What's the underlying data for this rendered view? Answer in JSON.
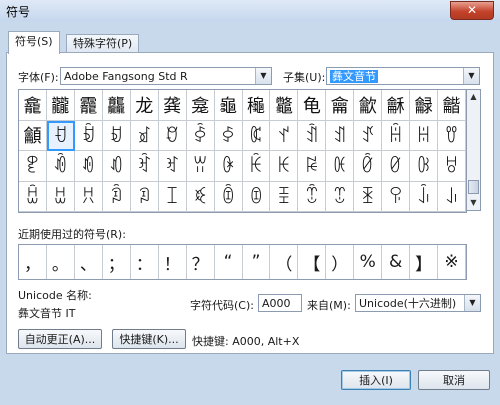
{
  "window": {
    "title": "符号",
    "close_icon": "✕"
  },
  "tabs": [
    {
      "label": "符号(S)",
      "active": true
    },
    {
      "label": "特殊字符(P)",
      "active": false
    }
  ],
  "font": {
    "label": "字体(F):",
    "value": "Adobe Fangsong Std R"
  },
  "subset": {
    "label": "子集(U):",
    "value": "彝文音节"
  },
  "symbols": [
    [
      "龕",
      "龖",
      "龗",
      "龘",
      "龙",
      "龚",
      "龛",
      "龜",
      "龝",
      "龞",
      "龟",
      "龠",
      "龡",
      "龢",
      "龣",
      "龤"
    ],
    [
      "龥",
      "ꀀ",
      "ꀁ",
      "ꀂ",
      "ꀃ",
      "ꀄ",
      "ꀅ",
      "ꀆ",
      "ꀇ",
      "ꀈ",
      "ꀉ",
      "ꀊ",
      "ꀋ",
      "ꀌ",
      "ꀍ",
      "ꀎ"
    ],
    [
      "ꀏ",
      "ꀐ",
      "ꀑ",
      "ꀒ",
      "ꀓ",
      "ꀔ",
      "ꀕ",
      "ꀖ",
      "ꀗ",
      "ꀘ",
      "ꀙ",
      "ꀚ",
      "ꀛ",
      "ꀜ",
      "ꀝ",
      "ꀞ"
    ],
    [
      "ꀟ",
      "ꀠ",
      "ꀡ",
      "ꀢ",
      "ꀣ",
      "ꀤ",
      "ꀥ",
      "ꀦ",
      "ꀧ",
      "ꀨ",
      "ꀩ",
      "ꀪ",
      "ꀫ",
      "ꀬ",
      "ꀭ",
      "ꀮ"
    ]
  ],
  "selected_symbol": "ꀀ",
  "recent": {
    "label": "近期使用过的符号(R):",
    "items": [
      "，",
      "。",
      "、",
      "；",
      "：",
      "！",
      "？",
      "“",
      "”",
      "（",
      "【",
      "）",
      "%",
      "&",
      "】",
      "※"
    ]
  },
  "unicode": {
    "label": "Unicode 名称:",
    "value": "彝文音节 IT"
  },
  "charcode": {
    "label": "字符代码(C):",
    "value": "A000"
  },
  "from": {
    "label": "来自(M):",
    "value": "Unicode(十六进制)"
  },
  "buttons": {
    "autocorrect": "自动更正(A)...",
    "shortcut_key": "快捷键(K)...",
    "shortcut_info": "快捷键: A000, Alt+X",
    "insert": "插入(I)",
    "cancel": "取消"
  },
  "icons": {
    "dropdown": "▼",
    "scroll_up": "▲",
    "scroll_down": "▼"
  }
}
